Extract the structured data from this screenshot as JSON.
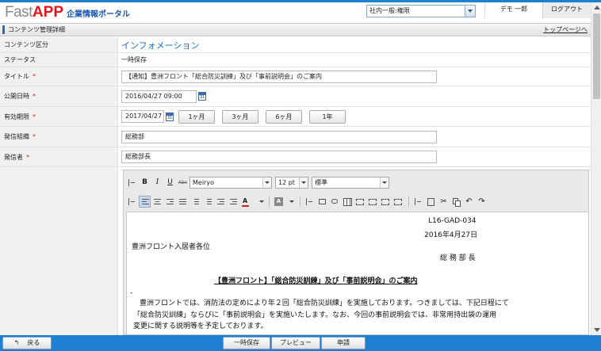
{
  "header": {
    "logo_fast": "Fast",
    "logo_app": "APP",
    "logo_portal": "企業情報ポータル",
    "role_select": "社内一般:権限",
    "user_name": "デモ 一郎",
    "logout": "ログアウト"
  },
  "titlebar": {
    "title": "コンテンツ管理詳細",
    "top_link": "トップページへ"
  },
  "form": {
    "category_label": "コンテンツ区分",
    "category_value": "インフォメーション",
    "status_label": "ステータス",
    "status_value": "一時保存",
    "title_label": "タイトル",
    "title_value": "【通知】豊洲フロント「総合防災訓練」及び「事前説明会」のご案内",
    "publish_label": "公開日時",
    "publish_value": "2016/04/27 09:00",
    "expiry_label": "有効期限",
    "expiry_value": "2017/04/27",
    "expiry_buttons": [
      "1ヶ月",
      "3ヶ月",
      "6ヶ月",
      "1年"
    ],
    "org_label": "発信組織",
    "org_value": "総務部",
    "sender_label": "発信者",
    "sender_value": "総務部長",
    "required_mark": "*"
  },
  "editor": {
    "font_family": "Meiryo",
    "font_size": "12 pt",
    "paragraph_style": "標準",
    "doc": {
      "line1": "L16-GAD-034",
      "line2": "2016年4月27日",
      "line3": "豊洲フロント入居者各位",
      "line4": "総 務 部 長",
      "heading": "【豊洲フロント】「総合防災訓練」及び「事前説明会」のご案内",
      "dash": "-",
      "body1": "豊洲フロントでは、消防法の定めにより年２回「総合防災訓練」を実施しております。つきましては、下記日程にて",
      "body2": "「総合防災訓練」ならびに「事前説明会」を実施いたします。なお、今回の事前説明会では、非常用持出袋の運用",
      "body3": "変更に関する説明等を予定しております。"
    }
  },
  "footer": {
    "back": "戻る",
    "save_temp": "一時保存",
    "preview": "プレビュー",
    "apply": "申請"
  },
  "colors": {
    "accent_blue": "#1f7fd0",
    "logo_red": "#e8141b",
    "required_red": "#d81e1e"
  }
}
